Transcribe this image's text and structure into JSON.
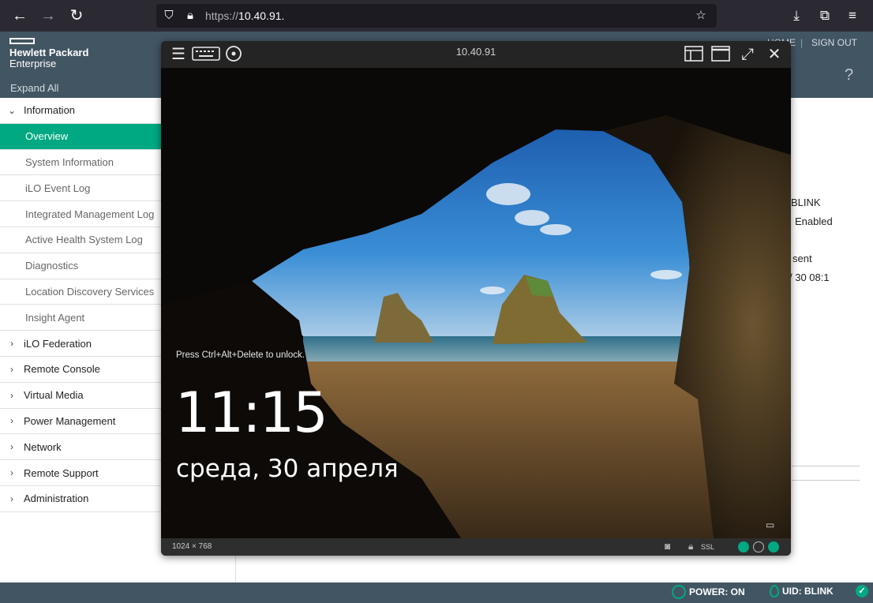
{
  "browser": {
    "url_prefix": "https://",
    "url_host": "10.40.91.",
    "icons": [
      "back-arrow-icon",
      "forward-arrow-icon",
      "reload-icon",
      "shield-icon",
      "lock-icon",
      "star-icon",
      "download-icon",
      "extensions-icon",
      "menu-icon"
    ]
  },
  "ilo": {
    "brand_line1": "Hewlett Packard",
    "brand_line2": "Enterprise",
    "expand_all": "Expand All",
    "header_links": {
      "home": "HOME",
      "sign_out": "SIGN OUT",
      "separator": "|"
    },
    "nav": [
      {
        "label": "Information",
        "expanded": true
      },
      {
        "label": "Overview",
        "active": true,
        "sub": true
      },
      {
        "label": "System Information",
        "sub": true
      },
      {
        "label": "iLO Event Log",
        "sub": true
      },
      {
        "label": "Integrated Management Log",
        "sub": true
      },
      {
        "label": "Active Health System Log",
        "sub": true
      },
      {
        "label": "Diagnostics",
        "sub": true
      },
      {
        "label": "Location Discovery Services",
        "sub": true
      },
      {
        "label": "Insight Agent",
        "sub": true
      },
      {
        "label": "iLO Federation"
      },
      {
        "label": "Remote Console"
      },
      {
        "label": "Virtual Media"
      },
      {
        "label": "Power Management"
      },
      {
        "label": "Network"
      },
      {
        "label": "Remote Support"
      },
      {
        "label": "Administration"
      }
    ],
    "content_fragments": [
      "BLINK",
      "Enabled",
      "sent",
      "/ 30 08:1"
    ],
    "status": {
      "power": "POWER: ON",
      "uid": "UID: BLINK"
    },
    "accent": "#01a982",
    "header_color": "#425563"
  },
  "console": {
    "title": "10.40.91",
    "resolution": "1024 × 768",
    "ssl": "SSL",
    "lock_hint": "Press Ctrl+Alt+Delete to unlock.",
    "time": "11:15",
    "date": "среда, 30 апреля"
  }
}
